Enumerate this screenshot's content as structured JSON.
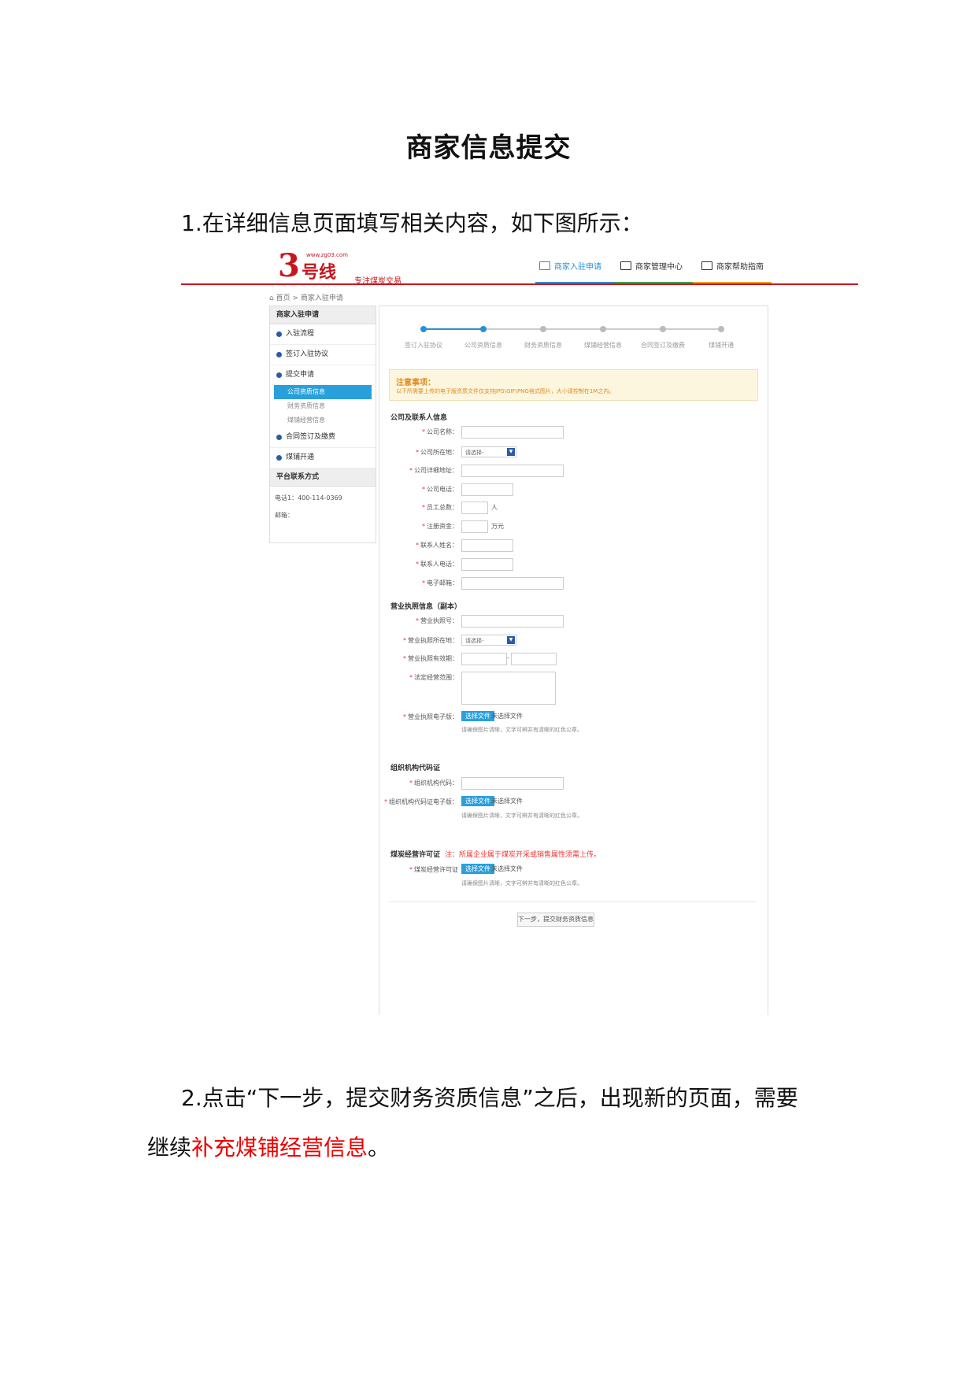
{
  "doc": {
    "title": "商家信息提交",
    "para1": "1.在详细信息页面填写相关内容，如下图所示：",
    "para2_a": "2.点击“下一步，提交财务资质信息”之后，出现新的页面，需要",
    "para3_a": "继续",
    "para3_red": "补充煤铺经营信息",
    "para3_b": "。"
  },
  "shot": {
    "logo": {
      "num": "3",
      "name": "号线",
      "url": "www.zg03.com",
      "slogan": "专注煤炭交易"
    },
    "nav": [
      "商家入驻申请",
      "商家管理中心",
      "商家帮助指南"
    ],
    "breadcrumb": "首页 > 商家入驻申请",
    "sidebar": {
      "head": "商家入驻申请",
      "items": [
        "入驻流程",
        "签订入驻协议",
        "提交申请"
      ],
      "subs": [
        "公司资质信息",
        "财务资质信息",
        "煤铺经营信息"
      ],
      "items2": [
        "合同签订及缴费",
        "煤铺开通"
      ],
      "contact_head": "平台联系方式",
      "phone": "电话1：400-114-0369",
      "email": "邮箱："
    },
    "steps": [
      "签订入驻协议",
      "公司资质信息",
      "财务资质信息",
      "煤铺经营信息",
      "合同签订及缴费",
      "煤铺开通"
    ],
    "notice": {
      "title": "注意事项：",
      "body": "以下所需要上传的电子版资质文件仅支持JPG\\GIF\\PNG格式图片，大小请控制在1M之内。"
    },
    "sections": {
      "company": "公司及联系人信息",
      "license": "营业执照信息（副本）",
      "org": "组织机构代码证",
      "coal": "煤炭经营许可证",
      "coal_note": "注：所属企业属于煤炭开采或销售属性须需上传。"
    },
    "fields": {
      "company_name": "公司名称：",
      "location": "公司所在地：",
      "address": "公司详细地址：",
      "phone": "公司电话：",
      "staff": "员工总数：",
      "capital": "注册资金：",
      "contact_name": "联系人姓名：",
      "contact_phone": "联系人电话：",
      "email": "电子邮箱：",
      "license_no": "营业执照号：",
      "license_loc": "营业执照所在地：",
      "license_term": "营业执照有效期：",
      "scope": "法定经营范围：",
      "license_file": "营业执照电子版：",
      "org_code": "组织机构代码：",
      "org_file": "组织机构代码证电子版：",
      "coal_file": "煤炭经营许可证"
    },
    "select_placeholder": "请选择-",
    "unit_person": "人",
    "unit_money": "万元",
    "file_btn": "选择文件",
    "file_none": "未选择文件",
    "file_hint": "请确保图片清晰，文字可辨并有清晰的红色公章。",
    "next_btn": "下一步，提交财务资质信息"
  }
}
